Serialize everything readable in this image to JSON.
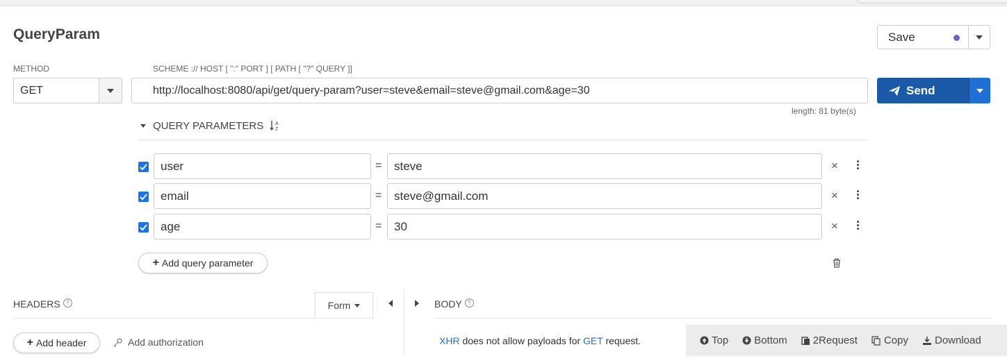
{
  "request": {
    "title": "QueryParam",
    "save_label": "Save",
    "method_label": "METHOD",
    "method_value": "GET",
    "url_hint": "SCHEME :// HOST [ \":\" PORT ] [ PATH [ \"?\" QUERY ]]",
    "url": "http://localhost:8080/api/get/query-param?user=steve&email=steve@gmail.com&age=30",
    "url_length": "length: 81 byte(s)",
    "send_label": "Send",
    "save_dot_color": "#6b67c9",
    "send_color": "#1a5aa8"
  },
  "query_params": {
    "header": "QUERY PARAMETERS",
    "rows": [
      {
        "key": "user",
        "value": "steve",
        "enabled": true
      },
      {
        "key": "email",
        "value": "steve@gmail.com",
        "enabled": true
      },
      {
        "key": "age",
        "value": "30",
        "enabled": true
      }
    ],
    "equals": "=",
    "add_label": "Add query parameter"
  },
  "headers": {
    "label": "HEADERS",
    "form_label": "Form",
    "add_header_label": "Add header",
    "add_auth_label": "Add authorization"
  },
  "body": {
    "label": "BODY",
    "note_xhr": "XHR",
    "note_mid": "does not allow payloads for",
    "note_method": "GET",
    "note_end": "request."
  },
  "bottom_bar": {
    "top": "Top",
    "bottom": "Bottom",
    "to_request": "2Request",
    "copy": "Copy",
    "download": "Download"
  }
}
